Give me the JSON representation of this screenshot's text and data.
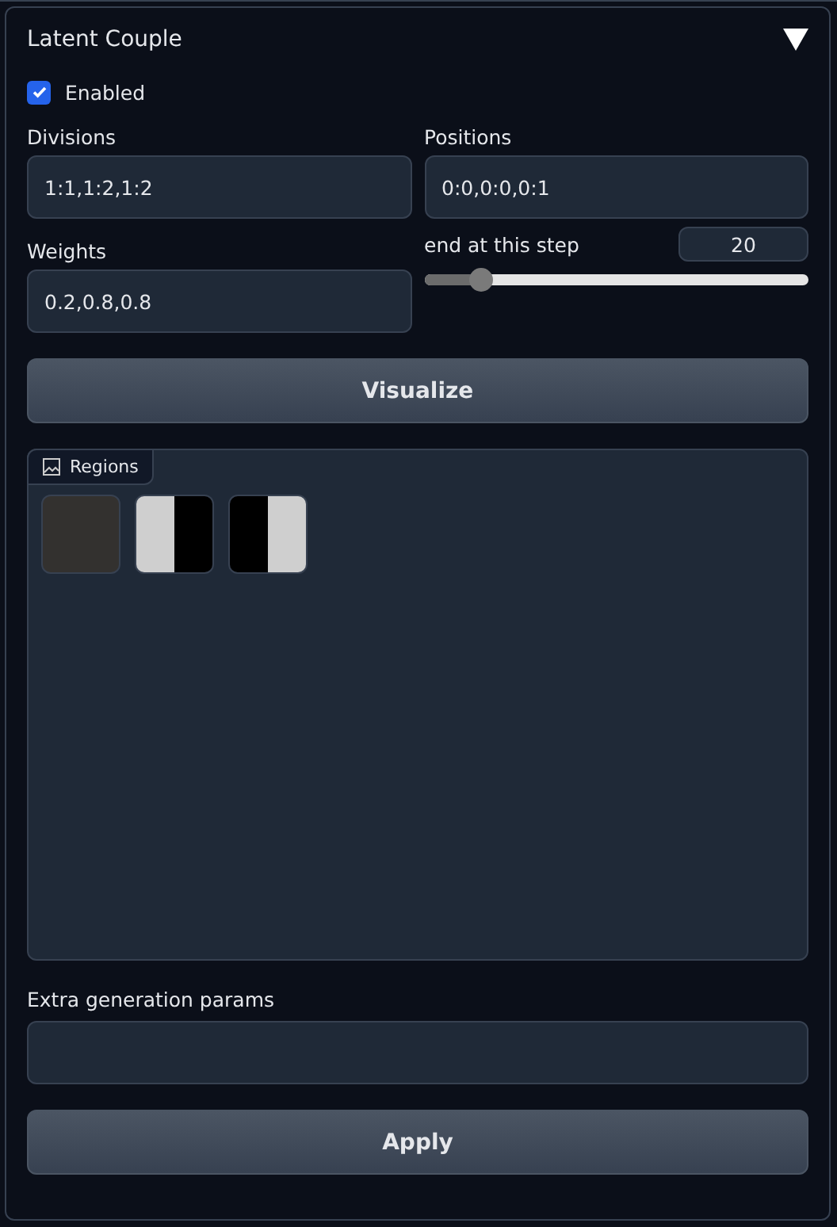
{
  "panel": {
    "title": "Latent Couple",
    "expanded": true
  },
  "enabled": {
    "label": "Enabled",
    "checked": true
  },
  "fields": [
    {
      "label": "Divisions",
      "value": "1:1,1:2,1:2"
    },
    {
      "label": "Positions",
      "value": "0:0,0:0,0:1"
    },
    {
      "label": "Weights",
      "value": "0.2,0.8,0.8"
    }
  ],
  "slider": {
    "label": "end at this step",
    "value": "20",
    "level": 0.15
  },
  "visualize_button": "Visualize",
  "gallery": {
    "label": "Regions",
    "items": [
      {
        "kind": "blank"
      },
      {
        "kind": "right-black"
      },
      {
        "kind": "left-black"
      }
    ]
  },
  "extra_params": {
    "label": "Extra generation params"
  },
  "apply_button": "Apply"
}
